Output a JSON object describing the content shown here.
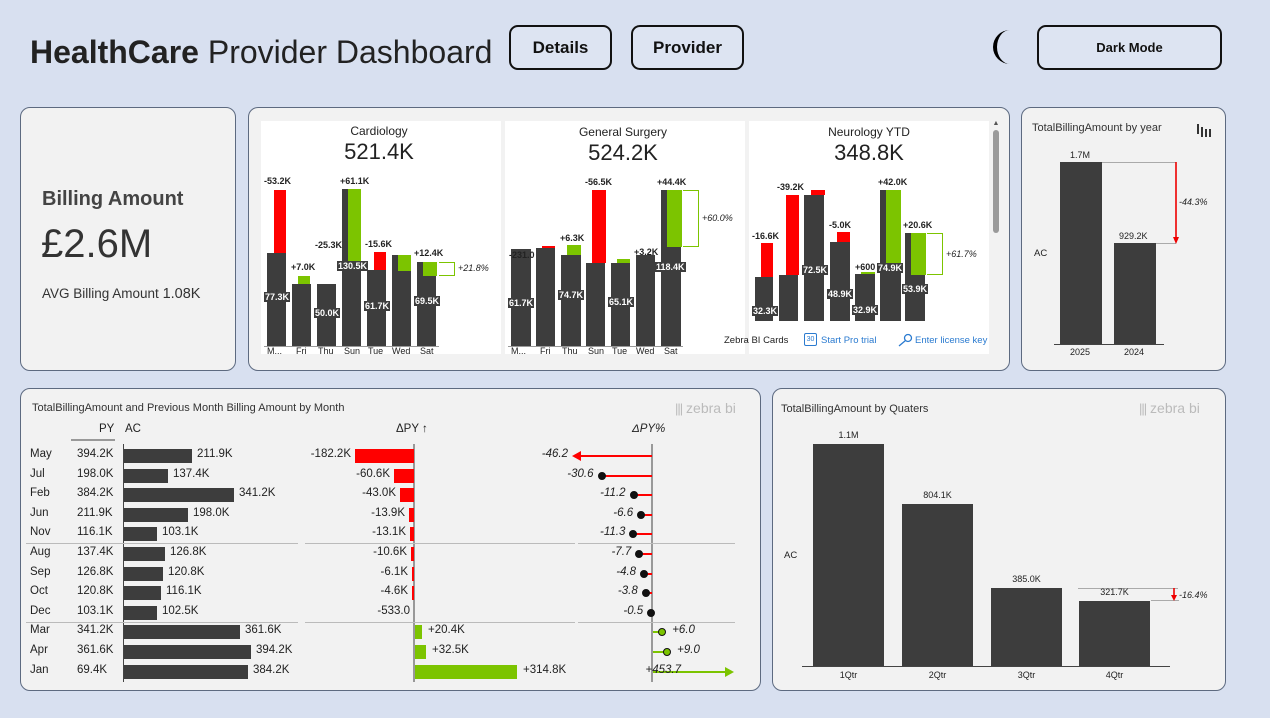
{
  "header": {
    "title_bold": "HealthCare",
    "title_rest": " Provider Dashboard",
    "details_label": "Details",
    "provider_label": "Provider",
    "dark_mode_label": "Dark Mode",
    "theme_icon": "moon-icon"
  },
  "kpi": {
    "title": "Billing Amount",
    "value": "£2.6M",
    "avg_label": "AVG Billing Amount",
    "avg_value": "1.08K"
  },
  "cards": {
    "footer": {
      "brand": "Zebra BI Cards",
      "trial_label": "Start Pro trial",
      "license_label": "Enter license key"
    },
    "items": [
      {
        "title": "Cardiology",
        "value": "521.4K",
        "pct": "+21.8%"
      },
      {
        "title": "General Surgery",
        "value": "524.2K",
        "pct": "+60.0%"
      },
      {
        "title": "Neurology YTD",
        "value": "348.8K",
        "pct": "+61.7%"
      }
    ]
  },
  "chart_data": [
    {
      "type": "bar",
      "title": "Cardiology",
      "categories": [
        "M...",
        "Fri",
        "Thu",
        "Sun",
        "Tue",
        "Wed",
        "Sat"
      ],
      "bar_labels": [
        "77.3K",
        "",
        "50.0K",
        "130.5K",
        "61.7K",
        "",
        "69.5K"
      ],
      "delta_labels": [
        "-53.2K",
        "+7.0K",
        "-25.3K",
        "+61.1K",
        "-15.6K",
        "",
        "+12.4K"
      ]
    },
    {
      "type": "bar",
      "title": "General Surgery",
      "categories": [
        "M...",
        "Fri",
        "Thu",
        "Sun",
        "Tue",
        "Wed",
        "Sat"
      ],
      "bar_labels": [
        "61.7K",
        "",
        "74.7K",
        "",
        "65.1K",
        "",
        "118.4K"
      ],
      "delta_labels": [
        "-231.0",
        "",
        "+6.3K",
        "-56.5K",
        "",
        "+3.2K",
        "+44.4K"
      ]
    },
    {
      "type": "bar",
      "title": "Neurology YTD",
      "bar_labels": [
        "32.3K",
        "",
        "72.5K",
        "48.9K",
        "32.9K",
        "74.9K",
        "53.9K"
      ],
      "delta_labels": [
        "-16.6K",
        "-39.2K",
        "",
        "-5.0K",
        "+600",
        "+42.0K",
        "+20.6K"
      ]
    },
    {
      "type": "bar",
      "title": "TotalBillingAmount by year",
      "categories": [
        "2025",
        "2024"
      ],
      "values": [
        1.7,
        0.9292
      ],
      "value_labels": [
        "1.7M",
        "929.2K"
      ],
      "row_label": "AC",
      "variance_label": "-44.3%"
    },
    {
      "type": "table",
      "title": "TotalBillingAmount and Previous Month Billing Amount by Month",
      "columns": [
        "PY",
        "AC",
        "ΔPY ↑",
        "ΔPY%"
      ],
      "rows": [
        {
          "month": "May",
          "py": "394.2K",
          "ac": "211.9K",
          "ac_val": 211.9,
          "dpy": "-182.2K",
          "dpy_val": -182.2,
          "dpct": "-46.2",
          "dpct_val": -46.2
        },
        {
          "month": "Jul",
          "py": "198.0K",
          "ac": "137.4K",
          "ac_val": 137.4,
          "dpy": "-60.6K",
          "dpy_val": -60.6,
          "dpct": "-30.6",
          "dpct_val": -30.6
        },
        {
          "month": "Feb",
          "py": "384.2K",
          "ac": "341.2K",
          "ac_val": 341.2,
          "dpy": "-43.0K",
          "dpy_val": -43.0,
          "dpct": "-11.2",
          "dpct_val": -11.2
        },
        {
          "month": "Jun",
          "py": "211.9K",
          "ac": "198.0K",
          "ac_val": 198.0,
          "dpy": "-13.9K",
          "dpy_val": -13.9,
          "dpct": "-6.6",
          "dpct_val": -6.6
        },
        {
          "month": "Nov",
          "py": "116.1K",
          "ac": "103.1K",
          "ac_val": 103.1,
          "dpy": "-13.1K",
          "dpy_val": -13.1,
          "dpct": "-11.3",
          "dpct_val": -11.3
        },
        {
          "month": "Aug",
          "py": "137.4K",
          "ac": "126.8K",
          "ac_val": 126.8,
          "dpy": "-10.6K",
          "dpy_val": -10.6,
          "dpct": "-7.7",
          "dpct_val": -7.7
        },
        {
          "month": "Sep",
          "py": "126.8K",
          "ac": "120.8K",
          "ac_val": 120.8,
          "dpy": "-6.1K",
          "dpy_val": -6.1,
          "dpct": "-4.8",
          "dpct_val": -4.8
        },
        {
          "month": "Oct",
          "py": "120.8K",
          "ac": "116.1K",
          "ac_val": 116.1,
          "dpy": "-4.6K",
          "dpy_val": -4.6,
          "dpct": "-3.8",
          "dpct_val": -3.8
        },
        {
          "month": "Dec",
          "py": "103.1K",
          "ac": "102.5K",
          "ac_val": 102.5,
          "dpy": "-533.0",
          "dpy_val": -0.533,
          "dpct": "-0.5",
          "dpct_val": -0.5
        },
        {
          "month": "Mar",
          "py": "341.2K",
          "ac": "361.6K",
          "ac_val": 361.6,
          "dpy": "+20.4K",
          "dpy_val": 20.4,
          "dpct": "+6.0",
          "dpct_val": 6.0
        },
        {
          "month": "Apr",
          "py": "361.6K",
          "ac": "394.2K",
          "ac_val": 394.2,
          "dpy": "+32.5K",
          "dpy_val": 32.5,
          "dpct": "+9.0",
          "dpct_val": 9.0
        },
        {
          "month": "Jan",
          "py": "69.4K",
          "ac": "384.2K",
          "ac_val": 384.2,
          "dpy": "+314.8K",
          "dpy_val": 314.8,
          "dpct": "+453.7",
          "dpct_val": 453.7
        }
      ]
    },
    {
      "type": "bar",
      "title": "TotalBillingAmount by Quaters",
      "categories": [
        "1Qtr",
        "2Qtr",
        "3Qtr",
        "4Qtr"
      ],
      "values": [
        1.1,
        0.8041,
        0.385,
        0.3217
      ],
      "value_labels": [
        "1.1M",
        "804.1K",
        "385.0K",
        "321.7K"
      ],
      "row_label": "AC",
      "variance_label": "-16.4%"
    }
  ],
  "brand": "zebra bi",
  "colors": {
    "background": "#d8e0f0",
    "bar": "#3d3d3d",
    "negative": "#ff0000",
    "positive": "#7cc400"
  }
}
